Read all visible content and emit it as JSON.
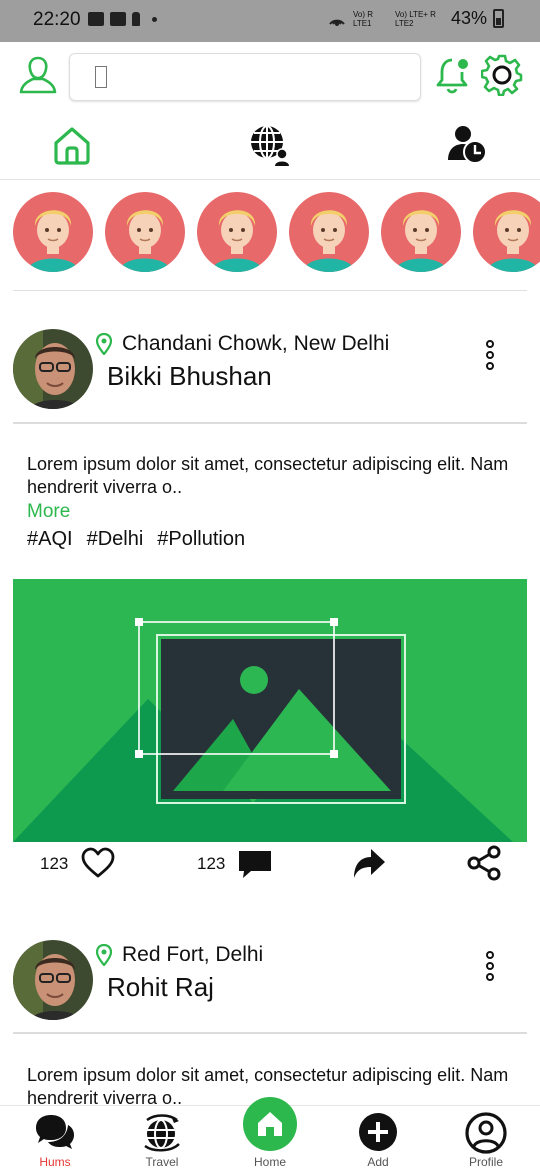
{
  "status_bar": {
    "time": "22:20",
    "network_line1": "Vo) R LTE1",
    "network_line2": "Vo) LTE+ R LTE2",
    "battery": "43%"
  },
  "header": {
    "search_placeholder": "",
    "profile_icon": "user-outline-icon",
    "notification_icon": "bell-icon",
    "settings_icon": "gear-icon"
  },
  "tabs": [
    {
      "icon": "home-icon",
      "active": true
    },
    {
      "icon": "globe-user-icon",
      "active": false
    },
    {
      "icon": "user-clock-icon",
      "active": false
    }
  ],
  "stories_count": 6,
  "posts": [
    {
      "location": "Chandani Chowk, New Delhi",
      "author": "Bikki Bhushan",
      "text": "Lorem ipsum dolor sit amet, consectetur adipiscing elit. Nam hendrerit viverra o..",
      "more_label": "More",
      "tags": [
        "#AQI",
        "#Delhi",
        "#Pollution"
      ],
      "likes": "123",
      "comments": "123"
    },
    {
      "location": "Red Fort, Delhi",
      "author": "Rohit Raj",
      "text": "Lorem ipsum dolor sit amet, consectetur adipiscing elit. Nam hendrerit viverra o.."
    }
  ],
  "bottom_nav": [
    {
      "label": "Hums",
      "icon": "chat-bubbles-icon",
      "active": true
    },
    {
      "label": "Travel",
      "icon": "globe-plane-icon",
      "active": false
    },
    {
      "label": "Home",
      "icon": "home-icon",
      "active": false
    },
    {
      "label": "Add",
      "icon": "plus-circle-icon",
      "active": false
    },
    {
      "label": "Profile",
      "icon": "user-circle-icon",
      "active": false
    }
  ],
  "colors": {
    "accent_green": "#2db84d",
    "story_bg": "#e8696a",
    "active_nav_label": "#e53935"
  }
}
